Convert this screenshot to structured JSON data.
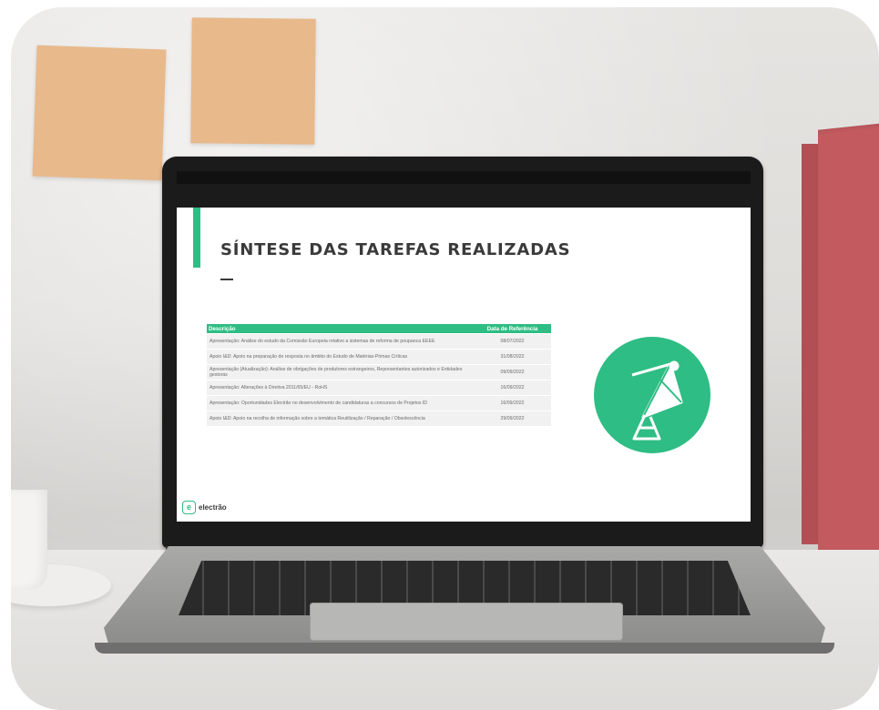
{
  "slide": {
    "title": "SÍNTESE DAS TAREFAS REALIZADAS",
    "table": {
      "headers": [
        "Descrição",
        "Data de Referência"
      ],
      "rows": [
        [
          "Apresentação: Análise do estudo da Comissão Europeia relativo a sistemas de reforma de poupanca EEEE",
          "08/07/2022"
        ],
        [
          "Apoio I&D: Apoio na preparação de resposta no âmbito do Estudo de Matérias-Primas Críticas",
          "31/08/2022"
        ],
        [
          "Apresentação (Atualização): Análise de obrigações de produtores estrangeiros, Representantes autorizados e Entidades gestoras",
          "09/09/2022"
        ],
        [
          "Apresentação: Alterações à Diretiva 2011/65/EU - RoHS",
          "16/09/2022"
        ],
        [
          "Apresentação: Oportunidades Electrão no desenvolvimento de candidaturas a concursos de Projetos ID",
          "16/09/2022"
        ],
        [
          "Apoio I&D: Apoio na recolha de informação sobre a temática Reutilização / Reparação / Obsolescência",
          "29/09/2022"
        ]
      ]
    },
    "logo_text": "electrão",
    "accent_color": "#2ebd84",
    "icon": "satellite-dish-icon"
  }
}
